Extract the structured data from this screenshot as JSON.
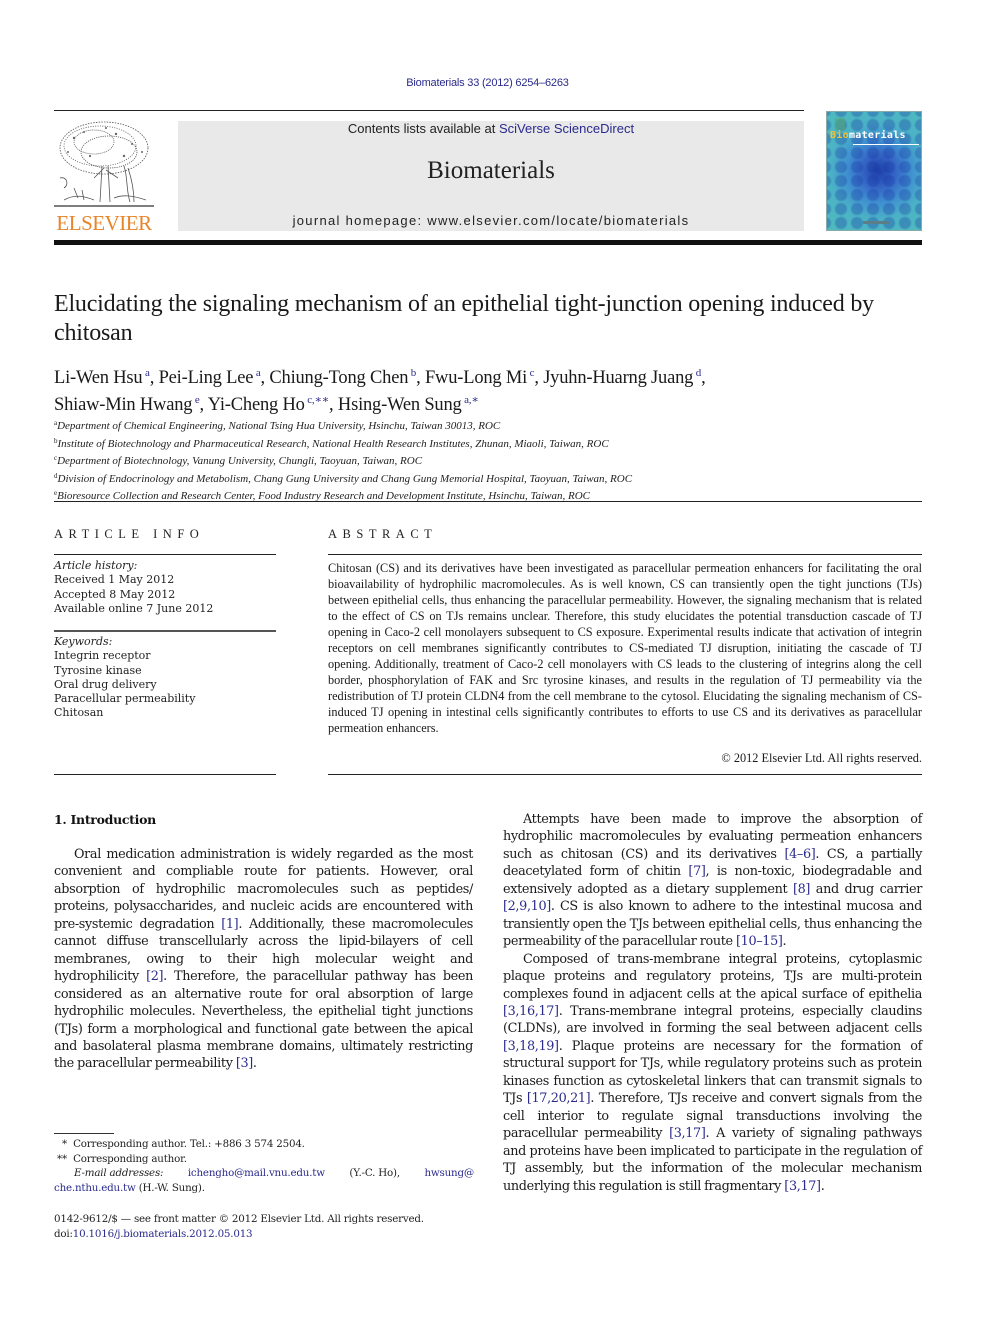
{
  "header": {
    "journal_reference": "Biomaterials 33 (2012) 6254–6263",
    "contents_prefix": "Contents lists available at ",
    "contents_link": "SciVerse ScienceDirect",
    "journal_name": "Biomaterials",
    "homepage": "journal homepage: www.elsevier.com/locate/biomaterials",
    "publisher_logo_text": "ELSEVIER",
    "cover_title_highlight": "Bio",
    "cover_title_rest": "materials",
    "colors": {
      "link": "#2a2a8c",
      "elsevier_orange": "#e8842a",
      "header_box": "#e9e9e9"
    }
  },
  "article": {
    "title": "Elucidating the signaling mechanism of an epithelial tight-junction opening induced by chitosan",
    "authors": [
      {
        "name": "Li-Wen Hsu",
        "affil": "a"
      },
      {
        "name": "Pei-Ling Lee",
        "affil": "a"
      },
      {
        "name": "Chiung-Tong Chen",
        "affil": "b"
      },
      {
        "name": "Fwu-Long Mi",
        "affil": "c"
      },
      {
        "name": "Jyuhn-Huarng Juang",
        "affil": "d"
      },
      {
        "name": "Shiaw-Min Hwang",
        "affil": "e"
      },
      {
        "name": "Yi-Cheng Ho",
        "affil": "c,**"
      },
      {
        "name": "Hsing-Wen Sung",
        "affil": "a,*"
      }
    ],
    "affiliations": [
      {
        "key": "a",
        "text": "Department of Chemical Engineering, National Tsing Hua University, Hsinchu, Taiwan 30013, ROC"
      },
      {
        "key": "b",
        "text": "Institute of Biotechnology and Pharmaceutical Research, National Health Research Institutes, Zhunan, Miaoli, Taiwan, ROC"
      },
      {
        "key": "c",
        "text": "Department of Biotechnology, Vanung University, Chungli, Taoyuan, Taiwan, ROC"
      },
      {
        "key": "d",
        "text": "Division of Endocrinology and Metabolism, Chang Gung University and Chang Gung Memorial Hospital, Taoyuan, Taiwan, ROC"
      },
      {
        "key": "e",
        "text": "Bioresource Collection and Research Center, Food Industry Research and Development Institute, Hsinchu, Taiwan, ROC"
      }
    ]
  },
  "article_info": {
    "heading": "ARTICLE INFO",
    "history_label": "Article history:",
    "history": [
      "Received 1 May 2012",
      "Accepted 8 May 2012",
      "Available online 7 June 2012"
    ],
    "keywords_label": "Keywords:",
    "keywords": [
      "Integrin receptor",
      "Tyrosine kinase",
      "Oral drug delivery",
      "Paracellular permeability",
      "Chitosan"
    ]
  },
  "abstract": {
    "heading": "ABSTRACT",
    "text": "Chitosan (CS) and its derivatives have been investigated as paracellular permeation enhancers for facilitating the oral bioavailability of hydrophilic macromolecules. As is well known, CS can transiently open the tight junctions (TJs) between epithelial cells, thus enhancing the paracellular permeability. However, the signaling mechanism that is related to the effect of CS on TJs remains unclear. Therefore, this study elucidates the potential transduction cascade of TJ opening in Caco-2 cell monolayers subsequent to CS exposure. Experimental results indicate that activation of integrin receptors on cell membranes significantly contributes to CS-mediated TJ disruption, initiating the cascade of TJ opening. Additionally, treatment of Caco-2 cell monolayers with CS leads to the clustering of integrins along the cell border, phosphorylation of FAK and Src tyrosine kinases, and results in the regulation of TJ permeability via the redistribution of TJ protein CLDN4 from the cell membrane to the cytosol. Elucidating the signaling mechanism of CS-induced TJ opening in intestinal cells significantly contributes to efforts to use CS and its derivatives as paracellular permeation enhancers.",
    "copyright": "© 2012 Elsevier Ltd. All rights reserved."
  },
  "body": {
    "section_heading": "1.  Introduction",
    "left_paragraph": [
      {
        "t": "Oral medication administration is widely regarded as the most convenient and compliable route for patients. However, oral absorption of hydrophilic macromolecules such as peptides/ proteins, polysaccharides, and nucleic acids are encountered with pre-systemic degradation "
      },
      {
        "ref": "[1]"
      },
      {
        "t": ". Additionally, these macromolecules cannot diffuse transcellularly across the lipid-bilayers of cell membranes, owing to their high molecular weight and hydrophilicity "
      },
      {
        "ref": "[2]"
      },
      {
        "t": ". Therefore, the paracellular pathway has been considered as an alternative route for oral absorption of large hydrophilic molecules. Nevertheless, the epithelial tight junctions (TJs) form a morphological and functional gate between the apical and basolateral plasma membrane domains, ultimately restricting the paracellular permeability "
      },
      {
        "ref": "[3]"
      },
      {
        "t": "."
      }
    ],
    "right_paragraph_1": [
      {
        "t": "Attempts have been made to improve the absorption of hydrophilic macromolecules by evaluating permeation enhancers such as chitosan (CS) and its derivatives "
      },
      {
        "ref": "[4–6]"
      },
      {
        "t": ". CS, a partially deacetylated form of chitin "
      },
      {
        "ref": "[7]"
      },
      {
        "t": ", is non-toxic, biodegradable and extensively adopted as a dietary supplement "
      },
      {
        "ref": "[8]"
      },
      {
        "t": " and drug carrier "
      },
      {
        "ref": "[2,9,10]"
      },
      {
        "t": ". CS is also known to adhere to the intestinal mucosa and transiently open the TJs between epithelial cells, thus enhancing the permeability of the paracellular route "
      },
      {
        "ref": "[10–15]"
      },
      {
        "t": "."
      }
    ],
    "right_paragraph_2": [
      {
        "t": "Composed of trans-membrane integral proteins, cytoplasmic plaque proteins and regulatory proteins, TJs are multi-protein complexes found in adjacent cells at the apical surface of epithelia "
      },
      {
        "ref": "[3,16,17]"
      },
      {
        "t": ". Trans-membrane integral proteins, especially claudins (CLDNs), are involved in forming the seal between adjacent cells "
      },
      {
        "ref": "[3,18,19]"
      },
      {
        "t": ". Plaque proteins are necessary for the formation of structural support for TJs, while regulatory proteins such as protein kinases function as cytoskeletal linkers that can transmit signals to TJs "
      },
      {
        "ref": "[17,20,21]"
      },
      {
        "t": ". Therefore, TJs receive and convert signals from the cell interior to regulate signal transductions involving the paracellular permeability "
      },
      {
        "ref": "[3,17]"
      },
      {
        "t": ". A variety of signaling pathways and proteins have been implicated to participate in the regulation of TJ assembly, but the information of the molecular mechanism underlying this regulation is still fragmentary "
      },
      {
        "ref": "[3,17]"
      },
      {
        "t": "."
      }
    ]
  },
  "footnotes": {
    "star1_mark": "*",
    "star1_text": "Corresponding author. Tel.: +886 3 574 2504.",
    "star2_mark": "**",
    "star2_text": "Corresponding author.",
    "email_label": "E-mail addresses:",
    "email1": "ichengho@mail.vnu.edu.tw",
    "email1_owner": "(Y.-C. Ho),",
    "email2_part1": "hwsung@",
    "email2_part2": "che.nthu.edu.tw",
    "email2_owner": " (H.-W. Sung)."
  },
  "front_matter": {
    "issn_line": "0142-9612/$ — see front matter © 2012 Elsevier Ltd. All rights reserved.",
    "doi_prefix": "doi:",
    "doi": "10.1016/j.biomaterials.2012.05.013"
  }
}
